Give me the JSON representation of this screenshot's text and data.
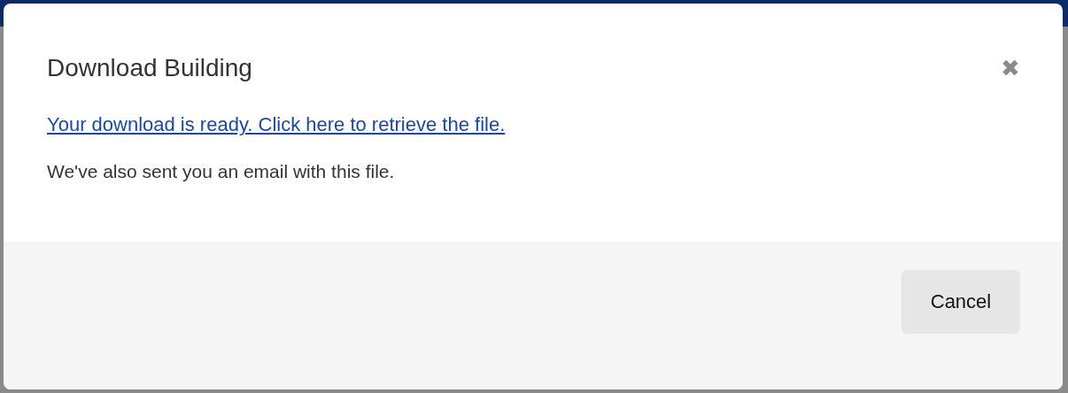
{
  "dialog": {
    "title": "Download Building",
    "close_label": "✖",
    "link": "Your download is ready. Click here to retrieve the file.",
    "message": "We've also sent you an email with this file.",
    "buttons": [
      {
        "label": "Cancel"
      }
    ]
  }
}
